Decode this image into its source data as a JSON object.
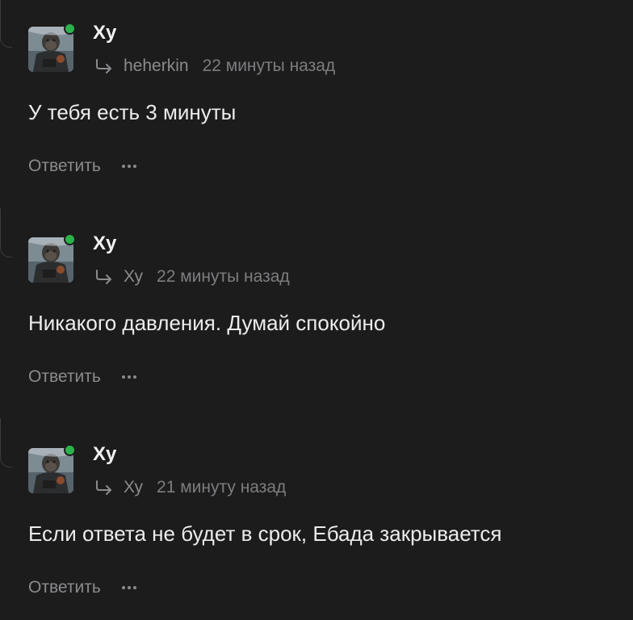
{
  "comments": [
    {
      "author": "Ху",
      "reply_to": "heherkin",
      "time": "22 минуты назад",
      "text": "У тебя есть 3 минуты",
      "reply_label": "Ответить",
      "online": true
    },
    {
      "author": "Ху",
      "reply_to": "Ху",
      "time": "22 минуты назад",
      "text": "Никакого давления. Думай спокойно",
      "reply_label": "Ответить",
      "online": true
    },
    {
      "author": "Ху",
      "reply_to": "Ху",
      "time": "21 минуту назад",
      "text": "Если ответа не будет в срок, Ебада закрывается",
      "reply_label": "Ответить",
      "online": true
    }
  ],
  "icons": {
    "reply": "reply-arrow-icon",
    "more": "more-dots-icon",
    "online": "online-status-icon"
  },
  "colors": {
    "background": "#1c1c1d",
    "online": "#29b34a",
    "muted_text": "#8b8b8e",
    "primary_text": "#ececed"
  }
}
